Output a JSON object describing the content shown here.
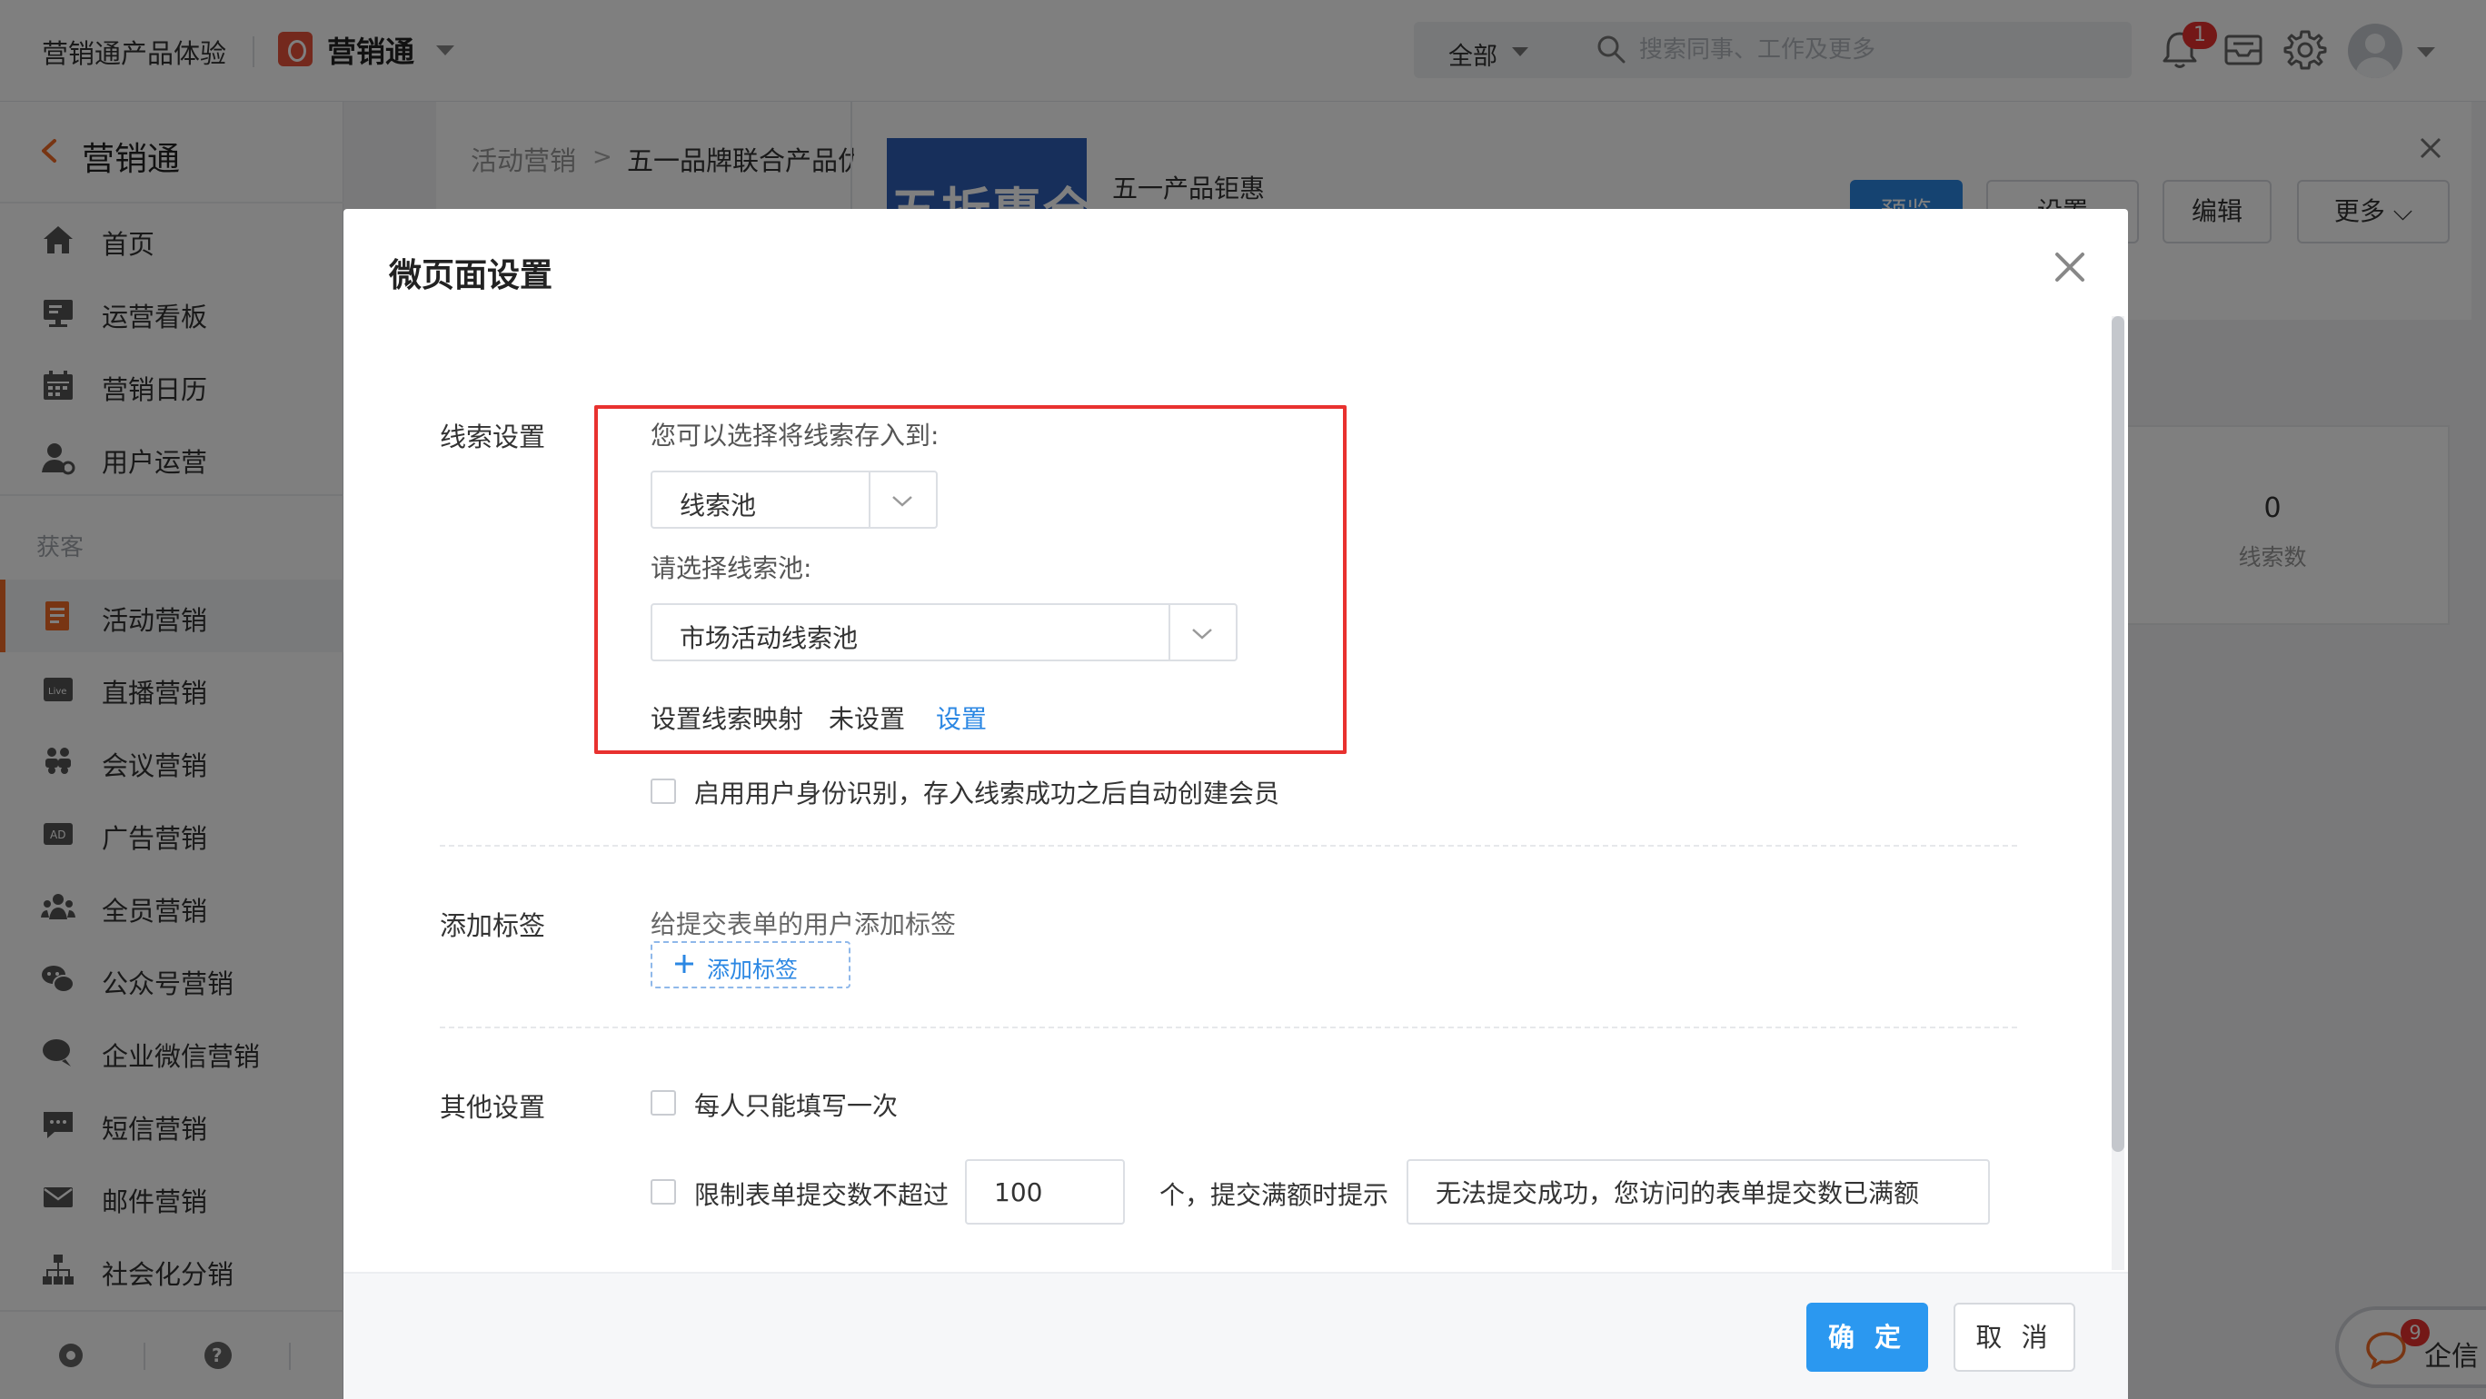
{
  "topbar": {
    "product": "营销通产品体验",
    "app_name": "营销通",
    "search_scope": "全部",
    "search_placeholder": "搜索同事、工作及更多",
    "notification_count": "1"
  },
  "sidebar": {
    "title": "营销通",
    "group_label": "获客",
    "items_top": [
      {
        "label": "首页",
        "icon": "home-icon"
      },
      {
        "label": "运营看板",
        "icon": "dashboard-icon"
      },
      {
        "label": "营销日历",
        "icon": "calendar-icon"
      },
      {
        "label": "用户运营",
        "icon": "user-ops-icon"
      }
    ],
    "items_group": [
      {
        "label": "活动营销",
        "icon": "activity-icon",
        "active": true
      },
      {
        "label": "直播营销",
        "icon": "live-icon"
      },
      {
        "label": "会议营销",
        "icon": "meeting-icon"
      },
      {
        "label": "广告营销",
        "icon": "ad-icon"
      },
      {
        "label": "全员营销",
        "icon": "team-icon"
      },
      {
        "label": "公众号营销",
        "icon": "wechat-icon"
      },
      {
        "label": "企业微信营销",
        "icon": "work-wechat-icon"
      },
      {
        "label": "短信营销",
        "icon": "sms-icon"
      },
      {
        "label": "邮件营销",
        "icon": "mail-icon"
      },
      {
        "label": "社会化分销",
        "icon": "distribution-icon"
      }
    ]
  },
  "background": {
    "breadcrumb_parent": "活动营销",
    "breadcrumb_current": "五一品牌联合产品优",
    "thumbnail_text": "五折惠全",
    "card_title": "五一产品钜惠",
    "buttons": {
      "preview": "预览",
      "settings": "设置",
      "edit": "编辑",
      "more": "更多"
    },
    "stat_value": "0",
    "stat_label": "线索数"
  },
  "modal": {
    "title": "微页面设置",
    "lead": {
      "section_label": "线索设置",
      "store_hint": "您可以选择将线索存入到:",
      "store_value": "线索池",
      "pool_hint": "请选择线索池:",
      "pool_value": "市场活动线索池",
      "mapping_label": "设置线索映射",
      "mapping_status": "未设置",
      "mapping_link": "设置",
      "identity_checkbox_label": "启用用户身份识别，存入线索成功之后自动创建会员"
    },
    "tags": {
      "section_label": "添加标签",
      "hint": "给提交表单的用户添加标签",
      "add_button": "添加标签"
    },
    "other": {
      "section_label": "其他设置",
      "once_label": "每人只能填写一次",
      "limit_label": "限制表单提交数不超过",
      "limit_value": "100",
      "limit_suffix": "个，提交满额时提示",
      "limit_message": "无法提交成功，您访问的表单提交数已满额"
    },
    "footer": {
      "confirm": "确 定",
      "cancel": "取 消"
    }
  },
  "chat": {
    "badge": "9",
    "label": "企信"
  },
  "colors": {
    "accent": "#2b87e3",
    "highlight": "#e8312f",
    "sidebar_active": "#f06b27"
  }
}
